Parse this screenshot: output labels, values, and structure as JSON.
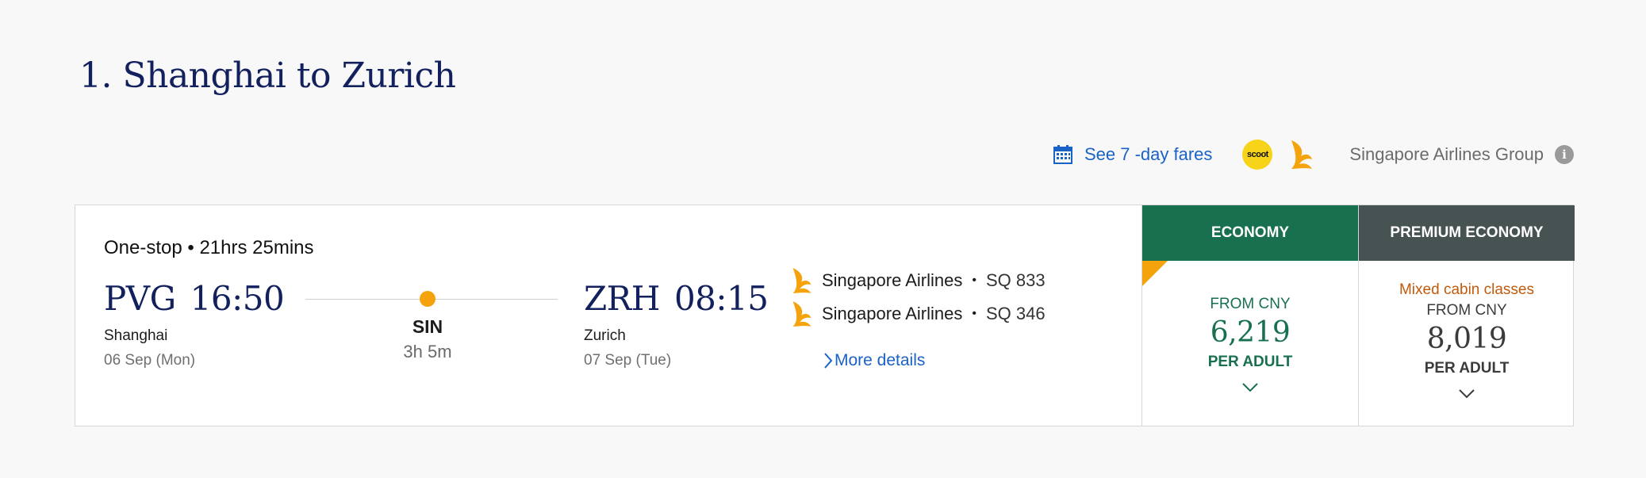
{
  "page": {
    "title": "1. Shanghai to Zurich"
  },
  "toolbar": {
    "fares_link": "See 7 -day fares",
    "scoot_logo_text": "scoot",
    "group_label": "Singapore Airlines Group",
    "info_symbol": "i"
  },
  "flight": {
    "summary": "One-stop • 21hrs 25mins",
    "departure": {
      "code": "PVG",
      "time": "16:50",
      "city": "Shanghai",
      "date": "06 Sep (Mon)"
    },
    "arrival": {
      "code": "ZRH",
      "time": "08:15",
      "city": "Zurich",
      "date": "07 Sep (Tue)"
    },
    "stop": {
      "code": "SIN",
      "duration": "3h 5m"
    },
    "segments": [
      {
        "airline": "Singapore Airlines",
        "separator": "•",
        "flight_no": "SQ 833"
      },
      {
        "airline": "Singapore Airlines",
        "separator": "•",
        "flight_no": "SQ 346"
      }
    ],
    "more_details": "More details"
  },
  "fares": {
    "economy": {
      "header": "ECONOMY",
      "from": "FROM CNY",
      "price": "6,219",
      "per": "PER ADULT"
    },
    "premium": {
      "header": "PREMIUM ECONOMY",
      "note": "Mixed cabin classes",
      "from": "FROM CNY",
      "price": "8,019",
      "per": "PER ADULT"
    }
  },
  "colors": {
    "title": "#12205e",
    "link": "#1a62c5",
    "economy": "#18704f",
    "premium": "#475352",
    "accent": "#f5a30c",
    "mixed_note": "#c25a0c"
  },
  "icons": [
    "calendar-icon",
    "scoot-logo",
    "singapore-airlines-bird-icon",
    "info-icon",
    "chevron-right-icon",
    "chevron-down-icon"
  ]
}
